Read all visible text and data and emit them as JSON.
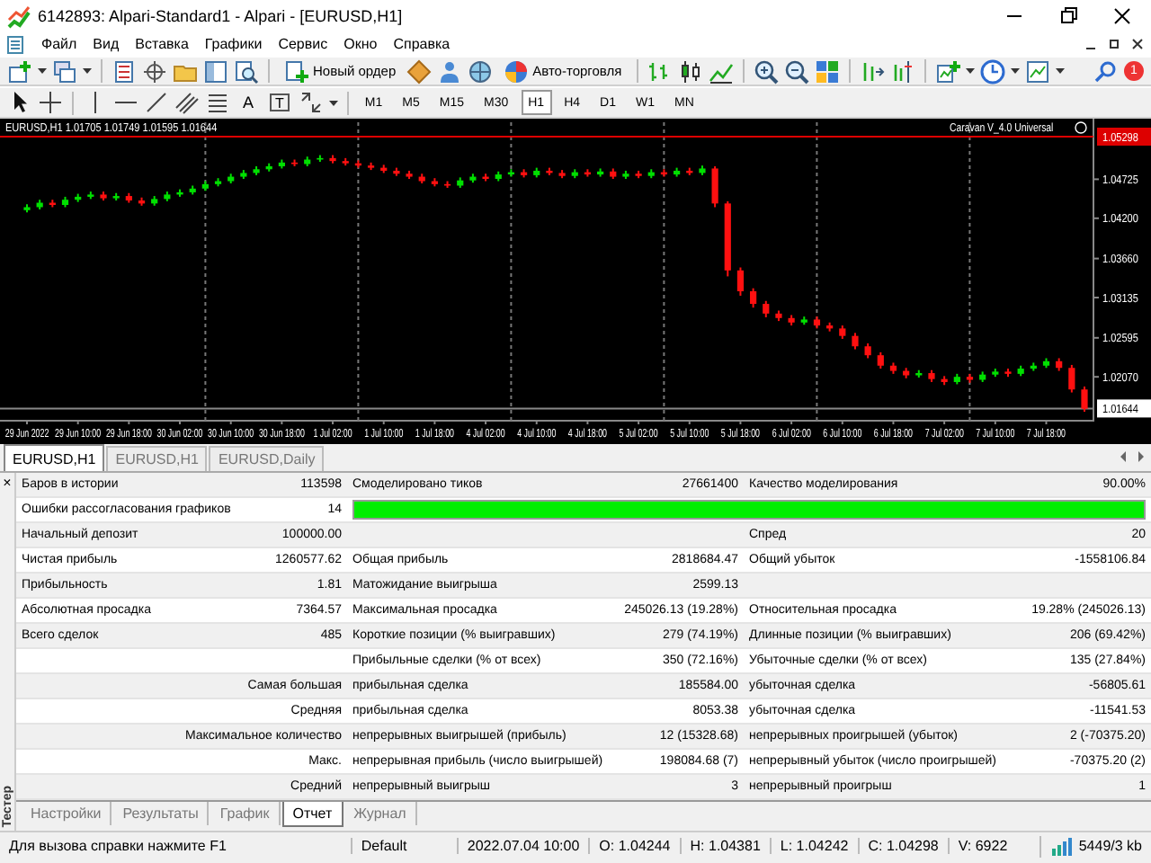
{
  "window": {
    "title": "6142893: Alpari-Standard1 - Alpari - [EURUSD,H1]"
  },
  "menu": [
    "Файл",
    "Вид",
    "Вставка",
    "Графики",
    "Сервис",
    "Окно",
    "Справка"
  ],
  "toolbar": {
    "buttons": [
      {
        "label": "Новый ордер"
      },
      {
        "label": "Авто-торговля"
      }
    ],
    "notification_count": "1"
  },
  "drawing_tools": {
    "text_tool": "A",
    "label_tool": "T"
  },
  "timeframes": [
    {
      "label": "M1",
      "selected": false
    },
    {
      "label": "M5",
      "selected": false
    },
    {
      "label": "M15",
      "selected": false
    },
    {
      "label": "M30",
      "selected": false
    },
    {
      "label": "H1",
      "selected": true
    },
    {
      "label": "H4",
      "selected": false
    },
    {
      "label": "D1",
      "selected": false
    },
    {
      "label": "W1",
      "selected": false
    },
    {
      "label": "MN",
      "selected": false
    }
  ],
  "chart": {
    "header": "EURUSD,H1  1.01705 1.01749 1.01595 1.01644",
    "indicator": "Caravan V_4.0 Universal",
    "chart_data": {
      "type": "candlestick",
      "ylim": [
        1.0148,
        1.0554
      ],
      "grid": true,
      "ref_lines": [
        {
          "axis": "y",
          "value": 1.05298,
          "label": "1.05298",
          "color": "#dd0000"
        },
        {
          "axis": "y",
          "value": 1.01644,
          "label": "1.01644",
          "color": "#888888"
        }
      ],
      "yticks": [
        {
          "value": 1.04725,
          "label": "1.04725"
        },
        {
          "value": 1.042,
          "label": "1.04200"
        },
        {
          "value": 1.0366,
          "label": "1.03660"
        },
        {
          "value": 1.03135,
          "label": "1.03135"
        },
        {
          "value": 1.02595,
          "label": "1.02595"
        },
        {
          "value": 1.0207,
          "label": "1.02070"
        }
      ],
      "categories": [
        "29 Jun 2022",
        null,
        null,
        null,
        "29 Jun 10:00",
        null,
        null,
        null,
        "29 Jun 18:00",
        null,
        null,
        null,
        "30 Jun 02:00",
        null,
        null,
        null,
        "30 Jun 10:00",
        null,
        null,
        null,
        "30 Jun 18:00",
        null,
        null,
        null,
        "1 Jul 02:00",
        null,
        null,
        null,
        "1 Jul 10:00",
        null,
        null,
        null,
        "1 Jul 18:00",
        null,
        null,
        null,
        "4 Jul 02:00",
        null,
        null,
        null,
        "4 Jul 10:00",
        null,
        null,
        null,
        "4 Jul 18:00",
        null,
        null,
        null,
        "5 Jul 02:00",
        null,
        null,
        null,
        "5 Jul 10:00",
        null,
        null,
        null,
        "5 Jul 18:00",
        null,
        null,
        null,
        "6 Jul 02:00",
        null,
        null,
        null,
        "6 Jul 10:00",
        null,
        null,
        null,
        "6 Jul 18:00",
        null,
        null,
        null,
        "7 Jul 02:00",
        null,
        null,
        null,
        "7 Jul 10:00",
        null,
        null,
        null,
        "7 Jul 18:00",
        null,
        null,
        null
      ],
      "ohlc": [
        [
          1.0431,
          1.0439,
          1.0428,
          1.0435
        ],
        [
          1.0435,
          1.0445,
          1.0432,
          1.0441
        ],
        [
          1.0441,
          1.0445,
          1.0435,
          1.0438
        ],
        [
          1.0438,
          1.0449,
          1.0435,
          1.0445
        ],
        [
          1.0445,
          1.0453,
          1.0442,
          1.0449
        ],
        [
          1.0449,
          1.0456,
          1.0446,
          1.0452
        ],
        [
          1.0452,
          1.0456,
          1.0444,
          1.0447
        ],
        [
          1.0447,
          1.0454,
          1.0444,
          1.045
        ],
        [
          1.045,
          1.0454,
          1.0441,
          1.0444
        ],
        [
          1.0444,
          1.0448,
          1.0437,
          1.044
        ],
        [
          1.044,
          1.045,
          1.0437,
          1.0446
        ],
        [
          1.0446,
          1.0456,
          1.0443,
          1.0452
        ],
        [
          1.0452,
          1.0459,
          1.0449,
          1.0455
        ],
        [
          1.0455,
          1.0464,
          1.0452,
          1.046
        ],
        [
          1.046,
          1.047,
          1.0457,
          1.0466
        ],
        [
          1.0466,
          1.0474,
          1.0463,
          1.047
        ],
        [
          1.047,
          1.048,
          1.0467,
          1.0476
        ],
        [
          1.0476,
          1.0485,
          1.0473,
          1.0481
        ],
        [
          1.0481,
          1.049,
          1.0478,
          1.0486
        ],
        [
          1.0486,
          1.0494,
          1.0483,
          1.049
        ],
        [
          1.049,
          1.0499,
          1.0487,
          1.0495
        ],
        [
          1.0495,
          1.0499,
          1.049,
          1.0493
        ],
        [
          1.0493,
          1.0503,
          1.049,
          1.0499
        ],
        [
          1.0499,
          1.0505,
          1.0496,
          1.0501
        ],
        [
          1.0501,
          1.0505,
          1.0494,
          1.0497
        ],
        [
          1.0497,
          1.0501,
          1.0491,
          1.0494
        ],
        [
          1.0494,
          1.0498,
          1.0488,
          1.0491
        ],
        [
          1.0491,
          1.0495,
          1.0485,
          1.0488
        ],
        [
          1.0488,
          1.0492,
          1.0481,
          1.0484
        ],
        [
          1.0484,
          1.0488,
          1.0477,
          1.048
        ],
        [
          1.048,
          1.0484,
          1.0473,
          1.0476
        ],
        [
          1.0476,
          1.048,
          1.0467,
          1.047
        ],
        [
          1.047,
          1.0474,
          1.0463,
          1.0466
        ],
        [
          1.0466,
          1.047,
          1.0461,
          1.0464
        ],
        [
          1.0464,
          1.0475,
          1.0461,
          1.0471
        ],
        [
          1.0471,
          1.048,
          1.0468,
          1.0476
        ],
        [
          1.0476,
          1.048,
          1.047,
          1.0473
        ],
        [
          1.0473,
          1.0483,
          1.047,
          1.0479
        ],
        [
          1.0479,
          1.0486,
          1.0476,
          1.0482
        ],
        [
          1.0482,
          1.0486,
          1.0475,
          1.0478
        ],
        [
          1.0478,
          1.0488,
          1.0475,
          1.0484
        ],
        [
          1.0484,
          1.0488,
          1.0478,
          1.0481
        ],
        [
          1.0481,
          1.0485,
          1.0474,
          1.0477
        ],
        [
          1.0477,
          1.0486,
          1.0474,
          1.0482
        ],
        [
          1.0482,
          1.0486,
          1.0476,
          1.0479
        ],
        [
          1.0479,
          1.0487,
          1.0476,
          1.0483
        ],
        [
          1.0483,
          1.0487,
          1.0473,
          1.0476
        ],
        [
          1.0476,
          1.0484,
          1.0473,
          1.048
        ],
        [
          1.048,
          1.0484,
          1.0474,
          1.0477
        ],
        [
          1.0477,
          1.0486,
          1.0474,
          1.0482
        ],
        [
          1.0482,
          1.0486,
          1.0476,
          1.0479
        ],
        [
          1.0479,
          1.0488,
          1.0476,
          1.0484
        ],
        [
          1.0484,
          1.0488,
          1.0478,
          1.0481
        ],
        [
          1.0481,
          1.0491,
          1.0478,
          1.0487
        ],
        [
          1.0487,
          1.049,
          1.0435,
          1.044
        ],
        [
          1.044,
          1.0443,
          1.0342,
          1.035
        ],
        [
          1.035,
          1.0354,
          1.0316,
          1.0322
        ],
        [
          1.0322,
          1.0326,
          1.03,
          1.0305
        ],
        [
          1.0305,
          1.0309,
          1.0287,
          1.0292
        ],
        [
          1.0292,
          1.0296,
          1.0282,
          1.0286
        ],
        [
          1.0286,
          1.029,
          1.0276,
          1.028
        ],
        [
          1.028,
          1.0288,
          1.0277,
          1.0284
        ],
        [
          1.0284,
          1.0288,
          1.0272,
          1.0276
        ],
        [
          1.0276,
          1.028,
          1.0268,
          1.0272
        ],
        [
          1.0272,
          1.0276,
          1.0258,
          1.0262
        ],
        [
          1.0262,
          1.0266,
          1.0244,
          1.0248
        ],
        [
          1.0248,
          1.0252,
          1.0232,
          1.0236
        ],
        [
          1.0236,
          1.024,
          1.0218,
          1.0222
        ],
        [
          1.0222,
          1.0226,
          1.0211,
          1.0215
        ],
        [
          1.0215,
          1.0219,
          1.0205,
          1.0209
        ],
        [
          1.0209,
          1.0216,
          1.0206,
          1.0212
        ],
        [
          1.0212,
          1.0216,
          1.02,
          1.0204
        ],
        [
          1.0204,
          1.0208,
          1.0196,
          1.02
        ],
        [
          1.02,
          1.0211,
          1.0197,
          1.0207
        ],
        [
          1.0207,
          1.0211,
          1.0199,
          1.0203
        ],
        [
          1.0203,
          1.0214,
          1.02,
          1.021
        ],
        [
          1.021,
          1.0218,
          1.0207,
          1.0214
        ],
        [
          1.0214,
          1.0218,
          1.0207,
          1.0211
        ],
        [
          1.0211,
          1.0222,
          1.0208,
          1.0218
        ],
        [
          1.0218,
          1.0226,
          1.0215,
          1.0222
        ],
        [
          1.0222,
          1.0232,
          1.0219,
          1.0228
        ],
        [
          1.0228,
          1.0232,
          1.0215,
          1.0219
        ],
        [
          1.0219,
          1.0223,
          1.0186,
          1.019
        ],
        [
          1.019,
          1.0194,
          1.016,
          1.0164
        ]
      ]
    }
  },
  "chart_tabs": [
    {
      "label": "EURUSD,H1",
      "selected": true
    },
    {
      "label": "EURUSD,H1",
      "selected": false
    },
    {
      "label": "EURUSD,Daily",
      "selected": false
    }
  ],
  "tester": {
    "title": "Тестер",
    "close": "×",
    "report": [
      {
        "kind": "basic",
        "label_1": "Баров в истории",
        "value_1": "113598",
        "label_2": "Смоделировано тиков",
        "value_2": "27661400",
        "label_3": "Качество моделирования",
        "value_3": "90.00%"
      },
      {
        "kind": "progress",
        "label_1": "Ошибки рассогласования графиков",
        "value_1": "14",
        "level": 1.0
      },
      {
        "kind": "basic",
        "label_1": "Начальный депозит",
        "value_1": "100000.00",
        "label_3": "Спред",
        "value_3": "20"
      },
      {
        "kind": "basic",
        "label_1": "Чистая прибыль",
        "value_1": "1260577.62",
        "label_2": "Общая прибыль",
        "value_2": "2818684.47",
        "label_3": "Общий убыток",
        "value_3": "-1558106.84"
      },
      {
        "kind": "basic",
        "label_1": "Прибыльность",
        "value_1": "1.81",
        "label_2": "Матожидание выигрыша",
        "value_2": "2599.13"
      },
      {
        "kind": "basic",
        "label_1": "Абсолютная просадка",
        "value_1": "7364.57",
        "label_2": "Максимальная просадка",
        "value_2": "245026.13 (19.28%)",
        "label_3": "Относительная просадка",
        "value_3": "19.28% (245026.13)"
      },
      {
        "kind": "basic",
        "label_1": "Всего сделок",
        "value_1": "485",
        "label_2": "Короткие позиции (% выигравших)",
        "value_2": "279 (74.19%)",
        "label_3": "Длинные позиции (% выигравших)",
        "value_3": "206 (69.42%)"
      },
      {
        "kind": "basic",
        "label_2": "Прибыльные сделки (% от всех)",
        "value_2": "350 (72.16%)",
        "label_3": "Убыточные сделки (% от всех)",
        "value_3": "135 (27.84%)"
      },
      {
        "kind": "detail",
        "label_1": "Самая большая",
        "label_2": "прибыльная сделка",
        "value_2": "185584.00",
        "label_3": "убыточная сделка",
        "value_3": "-56805.61"
      },
      {
        "kind": "detail",
        "label_1": "Средняя",
        "label_2": "прибыльная сделка",
        "value_2": "8053.38",
        "label_3": "убыточная сделка",
        "value_3": "-11541.53"
      },
      {
        "kind": "detail",
        "label_1": "Максимальное количество",
        "label_2": "непрерывных выигрышей (прибыль)",
        "value_2": "12 (15328.68)",
        "label_3": "непрерывных проигрышей (убыток)",
        "value_3": "2 (-70375.20)"
      },
      {
        "kind": "detail",
        "label_1": "Макс.",
        "label_2": "непрерывная прибыль (число выигрышей)",
        "value_2": "198084.68 (7)",
        "label_3": "непрерывный убыток (число проигрышей)",
        "value_3": "-70375.20 (2)"
      },
      {
        "kind": "detail",
        "label_1": "Средний",
        "label_2": "непрерывный выигрыш",
        "value_2": "3",
        "label_3": "непрерывный проигрыш",
        "value_3": "1"
      }
    ],
    "tabs": [
      {
        "label": "Настройки",
        "selected": false
      },
      {
        "label": "Результаты",
        "selected": false
      },
      {
        "label": "График",
        "selected": false
      },
      {
        "label": "Отчет",
        "selected": true
      },
      {
        "label": "Журнал",
        "selected": false
      }
    ]
  },
  "status_bar": {
    "help": "Для вызова справки нажмите F1",
    "profile": "Default",
    "time": "2022.07.04 10:00",
    "open": "O: 1.04244",
    "high": "H: 1.04381",
    "low": "L: 1.04242",
    "close": "C: 1.04298",
    "volume": "V: 6922",
    "traffic": "5449/3 kb"
  }
}
